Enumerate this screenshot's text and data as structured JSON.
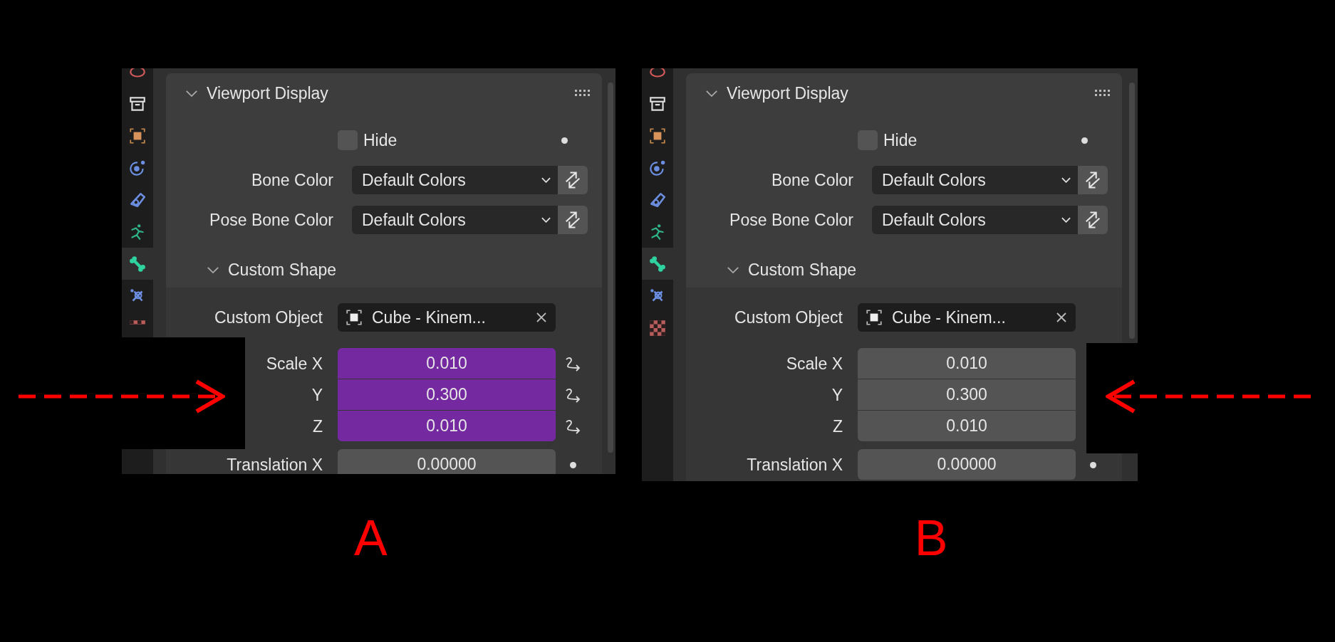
{
  "panels": [
    {
      "label": "A",
      "arrow": {
        "kind": "right"
      },
      "sidebar_tabs": [
        {
          "kind": "scene",
          "selected": false
        },
        {
          "kind": "collection",
          "selected": false
        },
        {
          "kind": "object",
          "selected": false
        },
        {
          "kind": "physics",
          "selected": false
        },
        {
          "kind": "constraints",
          "selected": false
        },
        {
          "kind": "pose",
          "selected": false
        },
        {
          "kind": "bone",
          "selected": true
        },
        {
          "kind": "boneconstraint",
          "selected": false
        },
        {
          "kind": "texture",
          "selected": false
        }
      ],
      "section": "Viewport Display",
      "hide": {
        "label": "Hide",
        "checked": false
      },
      "selectors": [
        {
          "label": "Bone Color",
          "value": "Default Colors"
        },
        {
          "label": "Pose Bone Color",
          "value": "Default Colors"
        }
      ],
      "subsection": "Custom Shape",
      "custom_object": {
        "label": "Custom Object",
        "value": "Cube - Kinem..."
      },
      "scale": {
        "driven": true,
        "rows": [
          {
            "label": "Scale X",
            "value": "0.010"
          },
          {
            "label": "Y",
            "value": "0.300"
          },
          {
            "label": "Z",
            "value": "0.010"
          }
        ]
      },
      "translation": {
        "label": "Translation X",
        "value": "0.00000"
      }
    },
    {
      "label": "B",
      "arrow": {
        "kind": "left"
      },
      "sidebar_tabs": [
        {
          "kind": "scene",
          "selected": false
        },
        {
          "kind": "collection",
          "selected": false
        },
        {
          "kind": "object",
          "selected": false
        },
        {
          "kind": "physics",
          "selected": false
        },
        {
          "kind": "constraints",
          "selected": false
        },
        {
          "kind": "pose",
          "selected": false
        },
        {
          "kind": "bone",
          "selected": true
        },
        {
          "kind": "boneconstraint",
          "selected": false
        },
        {
          "kind": "texture",
          "selected": false
        }
      ],
      "section": "Viewport Display",
      "hide": {
        "label": "Hide",
        "checked": false
      },
      "selectors": [
        {
          "label": "Bone Color",
          "value": "Default Colors"
        },
        {
          "label": "Pose Bone Color",
          "value": "Default Colors"
        }
      ],
      "subsection": "Custom Shape",
      "custom_object": {
        "label": "Custom Object",
        "value": "Cube - Kinem..."
      },
      "scale": {
        "driven": false,
        "rows": [
          {
            "label": "Scale X",
            "value": "0.010"
          },
          {
            "label": "Y",
            "value": "0.300"
          },
          {
            "label": "Z",
            "value": "0.010"
          }
        ]
      },
      "translation": {
        "label": "Translation X",
        "value": "0.00000"
      }
    }
  ]
}
